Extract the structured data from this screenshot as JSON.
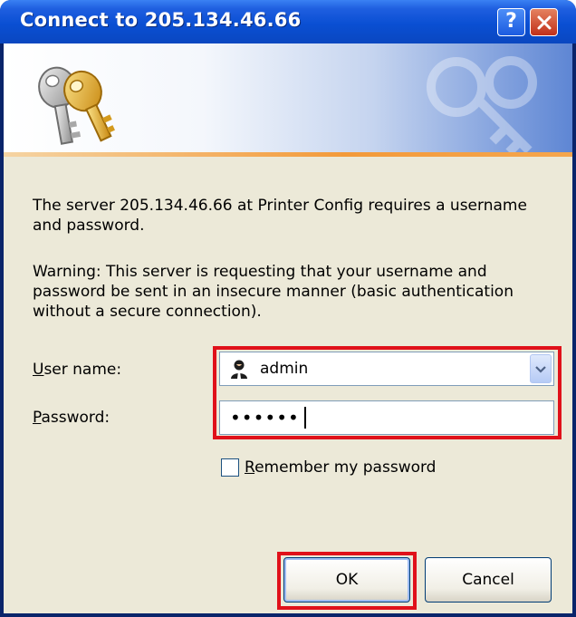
{
  "window": {
    "title": "Connect to 205.134.46.66",
    "help_label": "?",
    "close_label": "✕"
  },
  "message": {
    "line1": "The server 205.134.46.66 at Printer Config requires a username and password.",
    "warning": "Warning: This server is requesting that your username and password be sent in an insecure manner (basic authentication without a secure connection)."
  },
  "form": {
    "username_label_accel": "U",
    "username_label_rest": "ser name:",
    "username_value": "admin",
    "password_label_accel": "P",
    "password_label_rest": "assword:",
    "password_value": "••••••",
    "remember_accel": "R",
    "remember_rest": "emember my password",
    "remember_checked": false
  },
  "buttons": {
    "ok_label": "OK",
    "cancel_label": "Cancel"
  },
  "colors": {
    "titlebar": "#0a4fd3",
    "highlight": "#e0111a",
    "dialog_bg": "#ece9d8"
  }
}
